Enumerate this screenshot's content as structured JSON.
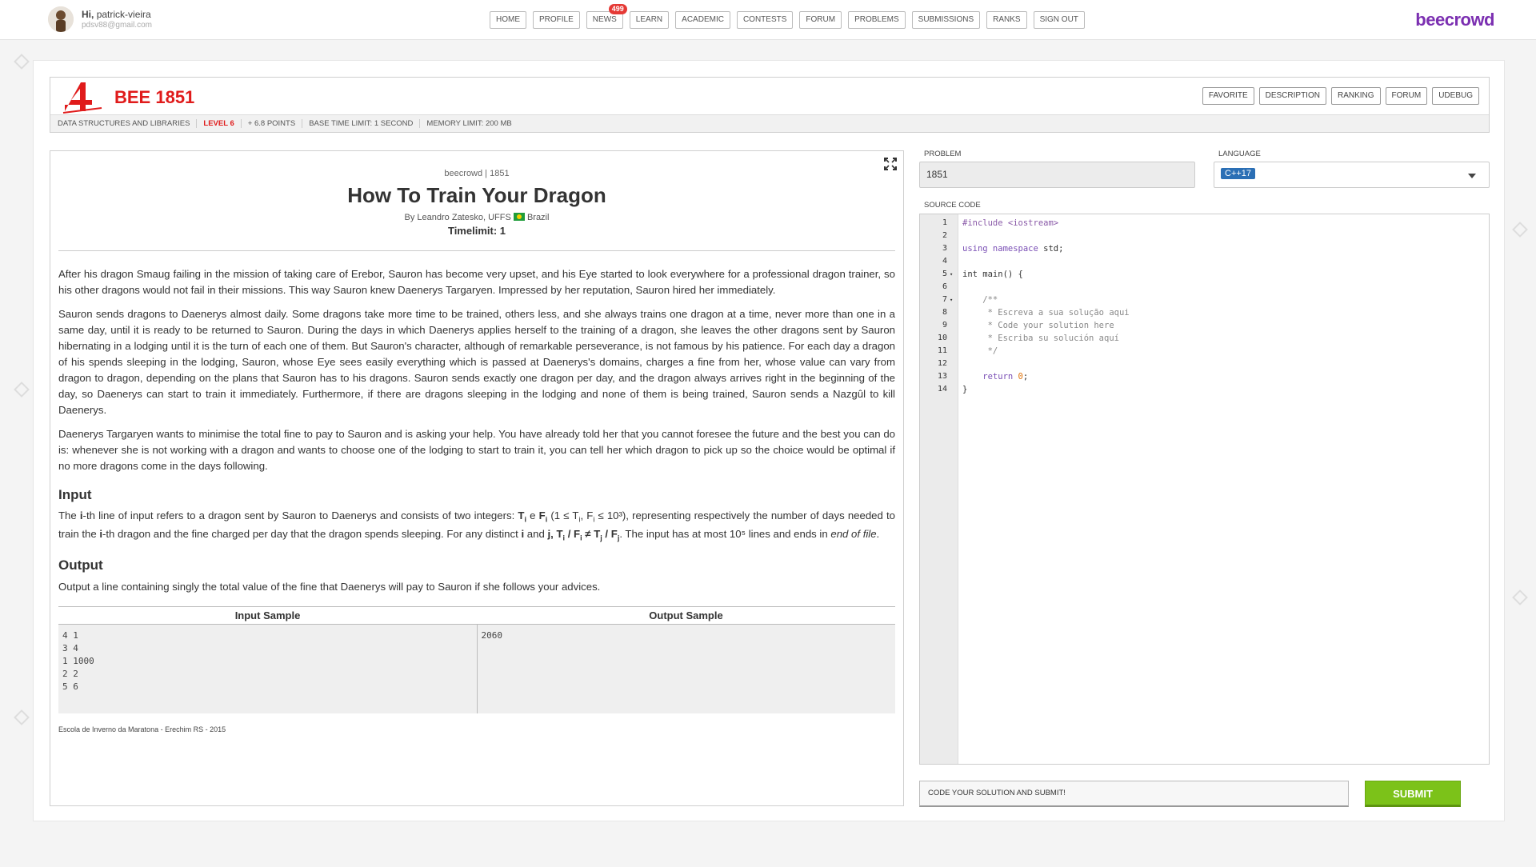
{
  "user": {
    "greeting": "Hi,",
    "name": "patrick-vieira",
    "email": "pdsv88@gmail.com"
  },
  "nav": {
    "items": [
      "HOME",
      "PROFILE",
      "NEWS",
      "LEARN",
      "ACADEMIC",
      "CONTESTS",
      "FORUM",
      "PROBLEMS",
      "SUBMISSIONS",
      "RANKS",
      "SIGN OUT"
    ],
    "news_badge": "499"
  },
  "brand": "beecrowd",
  "problem": {
    "id_label": "BEE 1851",
    "actions": [
      "FAVORITE",
      "DESCRIPTION",
      "RANKING",
      "FORUM",
      "UDEBUG"
    ],
    "meta": {
      "category": "DATA STRUCTURES AND LIBRARIES",
      "level": "LEVEL 6",
      "points": "+ 6.8 POINTS",
      "time": "BASE TIME LIMIT: 1 SECOND",
      "memory": "MEMORY LIMIT: 200 MB"
    },
    "crumb": "beecrowd | 1851",
    "title": "How To Train Your Dragon",
    "author": "By Leandro Zatesko, UFFS",
    "country": "Brazil",
    "timelimit": "Timelimit: 1",
    "paragraphs": [
      "After his dragon Smaug failing in the mission of taking care of Erebor, Sauron has become very upset, and his Eye started to look everywhere for a professional dragon trainer, so his other dragons would not fail in their missions. This way Sauron knew Daenerys Targaryen. Impressed by her reputation, Sauron hired her immediately.",
      "Sauron sends dragons to Daenerys almost daily. Some dragons take more time to be trained, others less, and she always trains one dragon at a time, never more than one in a same day, until it is ready to be returned to Sauron. During the days in which Daenerys applies herself to the training of a dragon, she leaves the other dragons sent by Sauron hibernating in a lodging until it is the turn of each one of them. But Sauron's character, although of remarkable perseverance, is not famous by his patience. For each day a dragon of his spends sleeping in the lodging, Sauron, whose Eye sees easily everything which is passed at Daenerys's domains, charges a fine from her, whose value can vary from dragon to dragon, depending on the plans that Sauron has to his dragons. Sauron sends exactly one dragon per day, and the dragon always arrives right in the beginning of the day, so Daenerys can start to train it immediately. Furthermore, if there are dragons sleeping in the lodging and none of them is being trained, Sauron sends a Nazgûl to kill Daenerys.",
      "Daenerys Targaryen wants to minimise the total fine to pay to Sauron and is asking your help. You have already told her that you cannot foresee the future and the best you can do is: whenever she is not working with a dragon and wants to choose one of the lodging to start to train it, you can tell her which dragon to pick up so the choice would be optimal if no more dragons come in the days following."
    ],
    "input_heading": "Input",
    "input_text": {
      "p1": "The ",
      "i": "i",
      "p2": "-th line of input refers to a dragon sent by Sauron to Daenerys and consists of two integers: ",
      "Ti": "T",
      "sub_i": "i",
      "and_e": " e ",
      "Fi": "F",
      "range": " (1 ≤ T",
      "range2": ", F",
      "range3": " ≤ 10³), representing respectively the number of days needed to train the ",
      "p3": "-th dragon and the fine charged per day that the dragon spends sleeping. For any distinct ",
      "and_j": " and ",
      "j": "j",
      "ratio": ", T",
      "slash": " / F",
      "neq": " ≠ T",
      "sub_j": "j",
      "p4": ". The input has at most 10⁵ lines and ends in ",
      "eof": "end of file",
      "p5": "."
    },
    "output_heading": "Output",
    "output_text": "Output a line containing singly the total value of the fine that Daenerys will pay to Sauron if she follows your advices.",
    "sample_headers": {
      "input": "Input Sample",
      "output": "Output Sample"
    },
    "sample_input": "4 1\n3 4\n1 1000\n2 2\n5 6",
    "sample_output": "2060",
    "footnote": "Escola de Inverno da Maratona - Erechim RS - 2015"
  },
  "editor": {
    "problem_label": "PROBLEM",
    "problem_value": "1851",
    "language_label": "LANGUAGE",
    "language_value": "C++17",
    "source_label": "SOURCE CODE",
    "lines": [
      {
        "n": "1",
        "fold": ""
      },
      {
        "n": "2",
        "fold": ""
      },
      {
        "n": "3",
        "fold": ""
      },
      {
        "n": "4",
        "fold": ""
      },
      {
        "n": "5",
        "fold": "▾"
      },
      {
        "n": "6",
        "fold": ""
      },
      {
        "n": "7",
        "fold": "▾"
      },
      {
        "n": "8",
        "fold": ""
      },
      {
        "n": "9",
        "fold": ""
      },
      {
        "n": "10",
        "fold": ""
      },
      {
        "n": "11",
        "fold": ""
      },
      {
        "n": "12",
        "fold": ""
      },
      {
        "n": "13",
        "fold": ""
      },
      {
        "n": "14",
        "fold": ""
      }
    ],
    "code": {
      "l1": "#include <iostream>",
      "l3a": "using namespace",
      "l3b": " std;",
      "l5": "int main() {",
      "l7": "    /**",
      "l8": "     * Escreva a sua solução aqui",
      "l9": "     * Code your solution here",
      "l10": "     * Escriba su solución aquí",
      "l11": "     */",
      "l13a": "    return ",
      "l13b": "0",
      "l13c": ";",
      "l14": "}"
    },
    "submit_note": "CODE YOUR SOLUTION AND SUBMIT!",
    "submit_label": "SUBMIT"
  },
  "colors": {
    "brand": "#7b2fb1",
    "danger": "#e01b1b",
    "submit": "#7cc219",
    "chip": "#2b6fb5"
  }
}
